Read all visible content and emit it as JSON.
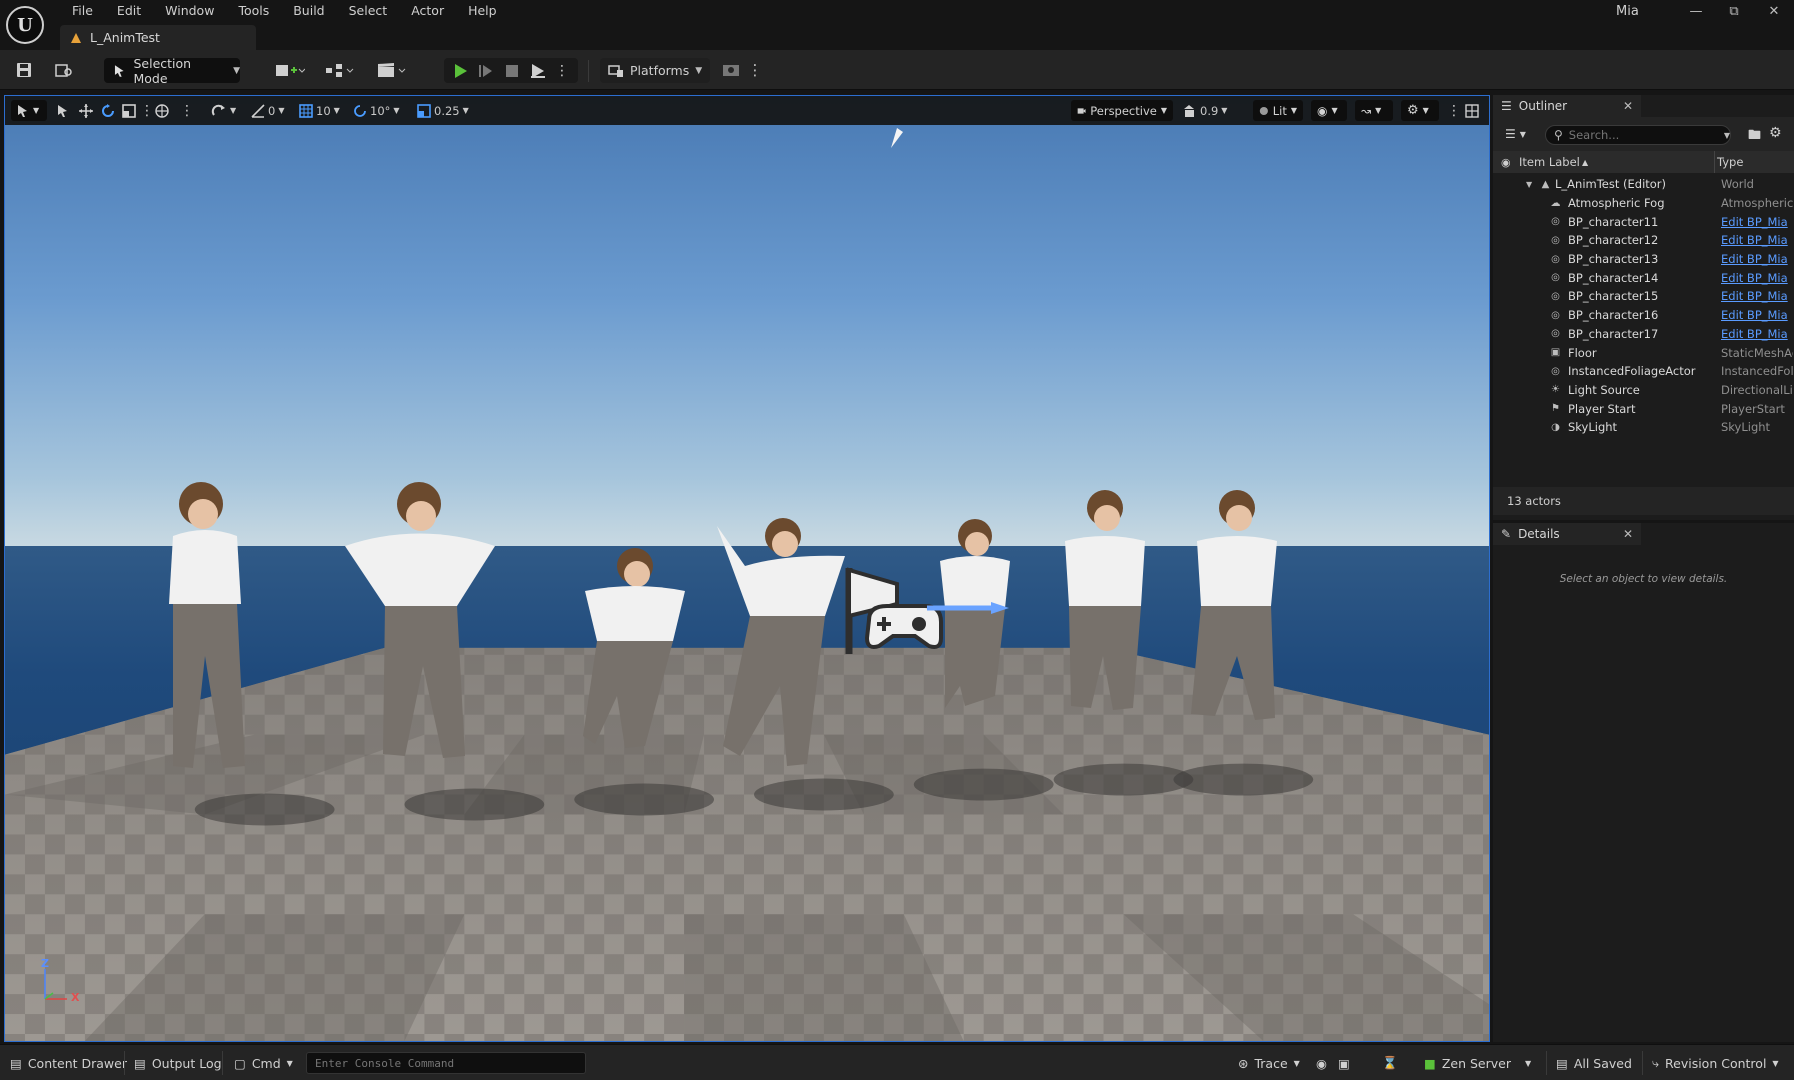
{
  "menu": [
    "File",
    "Edit",
    "Window",
    "Tools",
    "Build",
    "Select",
    "Actor",
    "Help"
  ],
  "document_tab": "L_AnimTest",
  "user": "Mia",
  "toolbar": {
    "mode_label": "Selection Mode",
    "platforms_label": "Platforms"
  },
  "viewport_toolbar": {
    "rotate_snap_angle": "0",
    "grid_snap": "10",
    "rotation_snap": "10°",
    "scale_snap": "0.25",
    "view_mode": "Perspective",
    "camera_speed": "0.9",
    "lighting_mode": "Lit"
  },
  "axis": {
    "z": "Z",
    "x": "X"
  },
  "outliner": {
    "title": "Outliner",
    "search_placeholder": "Search...",
    "col_label": "Item Label",
    "col_type": "Type",
    "rows": [
      {
        "label": "L_AnimTest (Editor)",
        "type": "World",
        "link": false,
        "icon": "level-icon"
      },
      {
        "label": "Atmospheric Fog",
        "type": "AtmosphericFog",
        "link": false,
        "icon": "fog-icon"
      },
      {
        "label": "BP_character11",
        "type": "Edit BP_Mia",
        "link": true,
        "icon": "actor-icon"
      },
      {
        "label": "BP_character12",
        "type": "Edit BP_Mia",
        "link": true,
        "icon": "actor-icon"
      },
      {
        "label": "BP_character13",
        "type": "Edit BP_Mia",
        "link": true,
        "icon": "actor-icon"
      },
      {
        "label": "BP_character14",
        "type": "Edit BP_Mia",
        "link": true,
        "icon": "actor-icon"
      },
      {
        "label": "BP_character15",
        "type": "Edit BP_Mia",
        "link": true,
        "icon": "actor-icon"
      },
      {
        "label": "BP_character16",
        "type": "Edit BP_Mia",
        "link": true,
        "icon": "actor-icon"
      },
      {
        "label": "BP_character17",
        "type": "Edit BP_Mia",
        "link": true,
        "icon": "actor-icon"
      },
      {
        "label": "Floor",
        "type": "StaticMeshActor",
        "link": false,
        "icon": "mesh-icon"
      },
      {
        "label": "InstancedFoliageActor",
        "type": "InstancedFoliageActor",
        "link": false,
        "icon": "actor-icon"
      },
      {
        "label": "Light Source",
        "type": "DirectionalLight",
        "link": false,
        "icon": "sun-icon"
      },
      {
        "label": "Player Start",
        "type": "PlayerStart",
        "link": false,
        "icon": "player-start-icon"
      },
      {
        "label": "SkyLight",
        "type": "SkyLight",
        "link": false,
        "icon": "skylight-icon"
      }
    ],
    "actor_count": "13 actors"
  },
  "details": {
    "title": "Details",
    "empty_message": "Select an object to view details."
  },
  "statusbar": {
    "content_drawer": "Content Drawer",
    "output_log": "Output Log",
    "cmd": "Cmd",
    "console_placeholder": "Enter Console Command",
    "trace": "Trace",
    "zen_server": "Zen Server",
    "all_saved": "All Saved",
    "revision_control": "Revision Control"
  },
  "colors": {
    "accent_blue": "#2c6ed0",
    "play_green": "#5ac13a",
    "link_blue": "#5a9bff"
  }
}
